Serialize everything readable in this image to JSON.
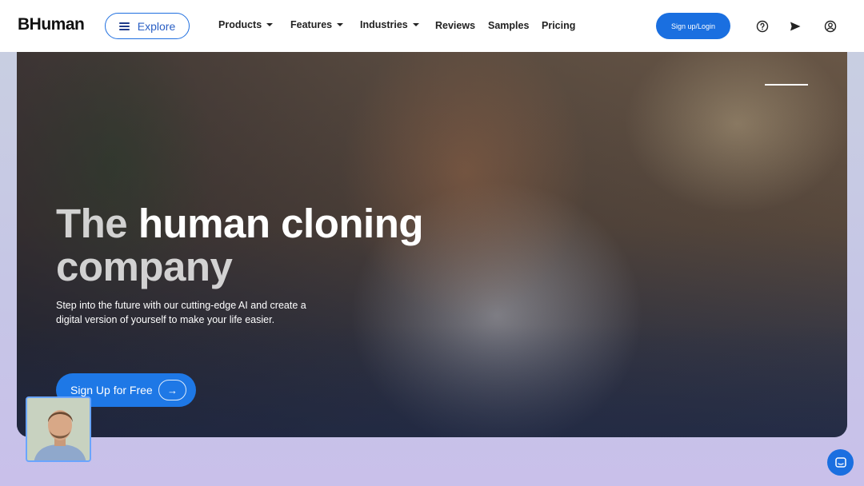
{
  "header": {
    "logo": "BHuman",
    "explore_label": "Explore",
    "nav": [
      {
        "label": "Products",
        "dropdown": true
      },
      {
        "label": "Features",
        "dropdown": true
      },
      {
        "label": "Industries",
        "dropdown": true
      },
      {
        "label": "Reviews",
        "dropdown": false
      },
      {
        "label": "Samples",
        "dropdown": false
      },
      {
        "label": "Pricing",
        "dropdown": false
      }
    ],
    "signup_label": "Sign up/Login",
    "icons": [
      "help-circle-icon",
      "send-icon",
      "account-icon"
    ]
  },
  "hero": {
    "title_part1": "The",
    "title_part2": "human cloning",
    "title_part3": "company",
    "subtitle": "Step into the future with our cutting-edge AI and create a digital version of yourself to make your life easier.",
    "cta_label": "Sign Up for Free"
  },
  "colors": {
    "accent": "#1a6fe0",
    "header_bg": "#ffffff",
    "page_bg": "#c8c8e6"
  }
}
